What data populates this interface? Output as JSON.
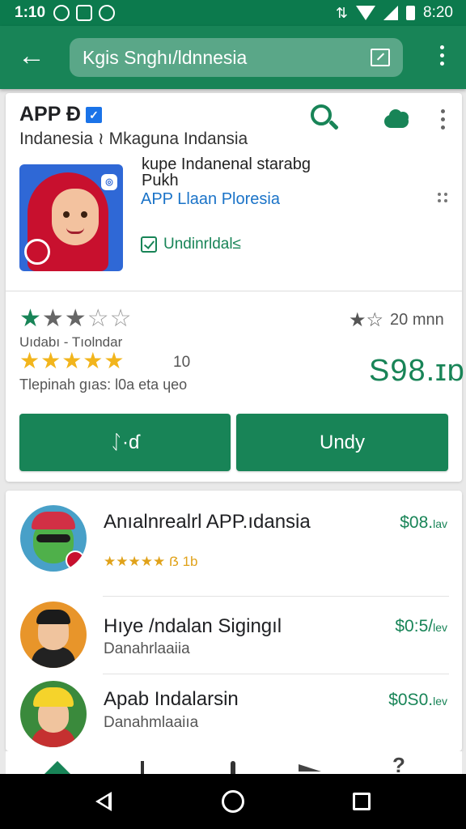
{
  "status_bar": {
    "time": "1:10",
    "clock_right": "8:20",
    "icons": [
      "notification-icon",
      "gallery-icon",
      "alert-icon",
      "vibrate-icon",
      "wifi-icon",
      "signal-icon",
      "battery-icon"
    ]
  },
  "app_bar": {
    "search_value": "Kgis Snghı/ldnnesia",
    "back_icon": "arrow-left-icon",
    "edit_icon": "edit-icon",
    "overflow_icon": "more-vert-icon"
  },
  "app": {
    "title": "APP Ð",
    "developer_line": "Indanesia ≀ Mkaguna Indansia",
    "tagline": "kupe Indanenal starabg\nPukh",
    "publisher": "APP Llaan Ploresia",
    "installed_label": "Undinrldal≤",
    "accent_color": "#188457"
  },
  "ratings": {
    "label_left": "Uıdabı - Tıolndar",
    "count": "10",
    "caption": "Tlepinah gıas: l0a eta ɥeo",
    "right_count": "20 mnn",
    "price": "S98.ɪɒ"
  },
  "buttons": {
    "left_label": "ᛇ·ɗ",
    "right_label": "Undy"
  },
  "list": [
    {
      "title": "Anıalnrealrl APP.ıdansia",
      "sub": "★★★★★ ẞ 1b",
      "price": "$08.",
      "price_suffix": "lav"
    },
    {
      "title": "Hıye /ndalan Sigingıl",
      "sub": "Danahrlaaiia",
      "price": "$0:5/",
      "price_suffix": "lev"
    },
    {
      "title": "Apab Indalarsin",
      "sub": "Danahmlaaiıa",
      "price": "$0S0.",
      "price_suffix": "lev"
    }
  ]
}
